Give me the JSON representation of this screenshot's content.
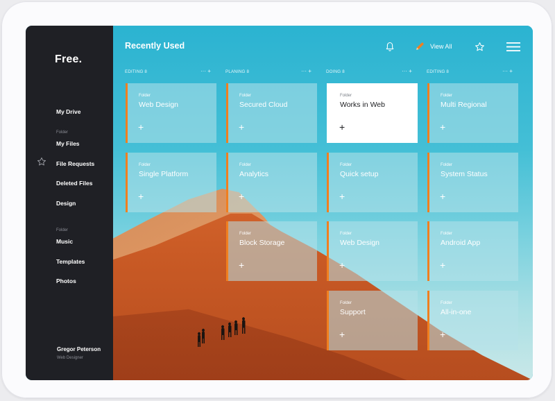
{
  "sidebar": {
    "logo": "Free.",
    "items": [
      {
        "sub": "",
        "label": "My Drive"
      },
      {
        "sub": "Folder",
        "label": "My Files"
      },
      {
        "sub": "",
        "label": "File Requests"
      },
      {
        "sub": "",
        "label": "Deleted Files"
      },
      {
        "sub": "",
        "label": "Design"
      },
      {
        "sub": "Folder",
        "label": "Music"
      },
      {
        "sub": "",
        "label": "Templates"
      },
      {
        "sub": "",
        "label": "Photos"
      }
    ],
    "user": {
      "name": "Gregor Peterson",
      "role": "Web Designer"
    }
  },
  "header": {
    "title": "Recently Used",
    "view_all": "View All",
    "icons": [
      "bell-icon",
      "pencil-icon",
      "star-icon",
      "menu-icon"
    ]
  },
  "columns": [
    {
      "name": "EDITING 8",
      "actions": "··· +"
    },
    {
      "name": "PLANING 8",
      "actions": "··· +"
    },
    {
      "name": "DOING 8",
      "actions": "··· +"
    },
    {
      "name": "EDITING 8",
      "actions": "··· +"
    }
  ],
  "cards": [
    {
      "type": "Folder",
      "title": "Web Design",
      "plus": "+"
    },
    {
      "type": "Folder",
      "title": "Secured Cloud",
      "plus": "+"
    },
    {
      "type": "Folder",
      "title": "Works in Web",
      "plus": "+",
      "active": true
    },
    {
      "type": "Folder",
      "title": "Multi Regional",
      "plus": "+"
    },
    {
      "type": "Folder",
      "title": "Single Platform",
      "plus": "+"
    },
    {
      "type": "Folder",
      "title": "Analytics",
      "plus": "+"
    },
    {
      "type": "Folder",
      "title": "Quick setup",
      "plus": "+"
    },
    {
      "type": "Folder",
      "title": "System Status",
      "plus": "+"
    },
    {
      "type": "Folder",
      "title": "Block Storage",
      "plus": "+"
    },
    {
      "type": "Folder",
      "title": "Web Design",
      "plus": "+"
    },
    {
      "type": "Folder",
      "title": "Android App",
      "plus": "+"
    },
    {
      "type": "Folder",
      "title": "Support",
      "plus": "+"
    },
    {
      "type": "Folder",
      "title": "All-in-one",
      "plus": "+"
    }
  ],
  "colors": {
    "sidebar": "#1f2025",
    "accent": "#f07f1f",
    "sky": "#2bb3d1",
    "dune": "#dd6f33"
  }
}
